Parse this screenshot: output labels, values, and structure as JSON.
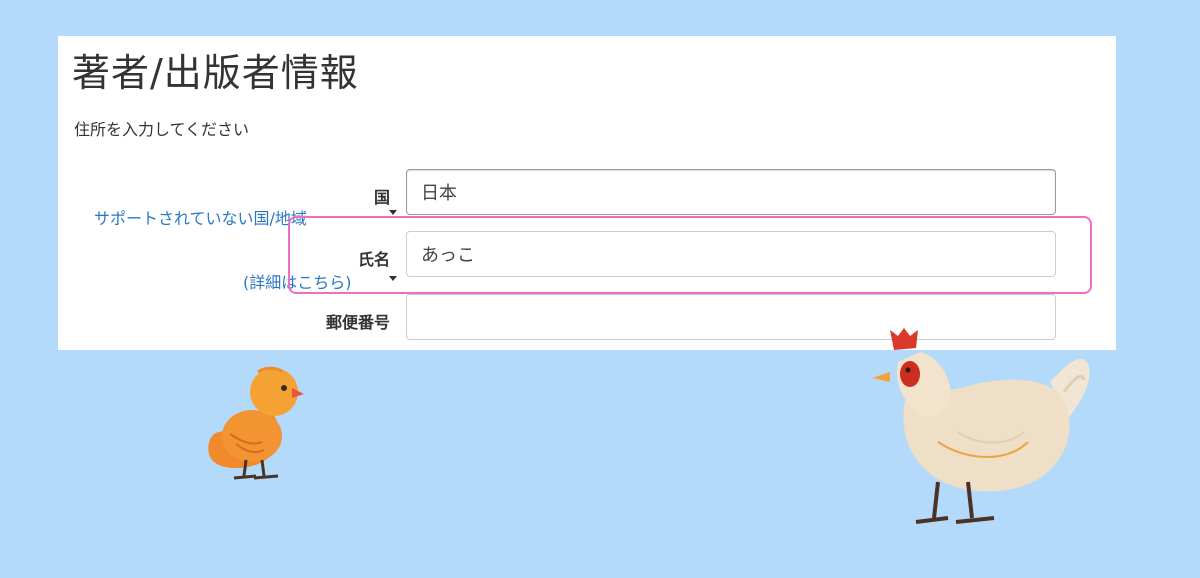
{
  "form": {
    "title": "著者/出版者情報",
    "subtitle": "住所を入力してください",
    "country": {
      "label": "国",
      "help_link": "サポートされていない国/地域",
      "value": "日本"
    },
    "name": {
      "label": "氏名",
      "help_link": "(詳細はこちら)",
      "value": "あっこ"
    },
    "postal": {
      "label": "郵便番号",
      "value": ""
    }
  },
  "colors": {
    "background": "#b3d9fb",
    "highlight": "#ec6fc6",
    "link": "#2a78c4"
  }
}
